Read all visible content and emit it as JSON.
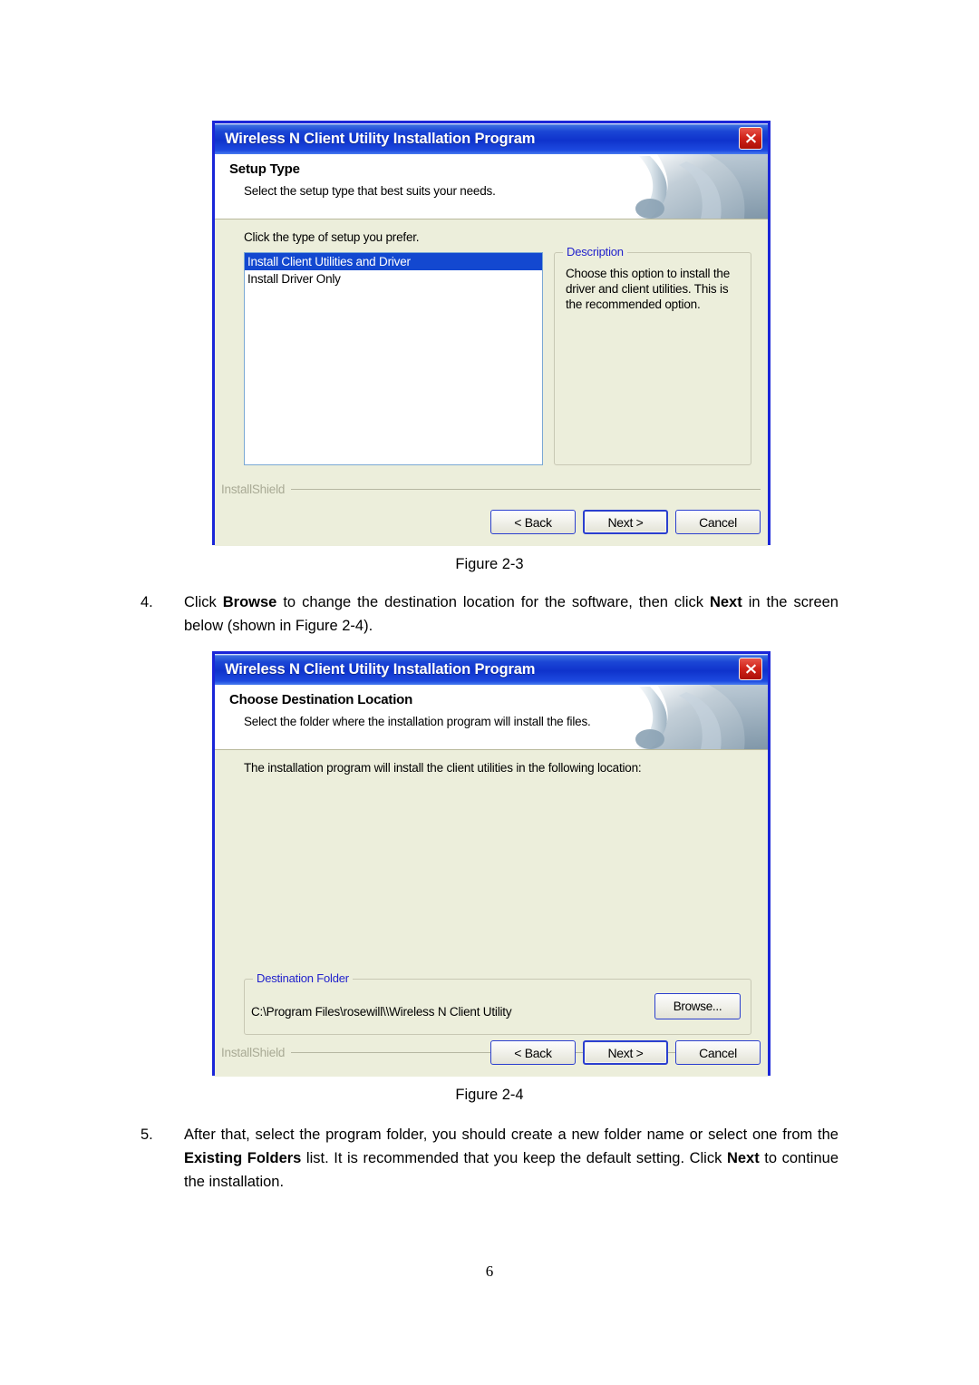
{
  "document": {
    "page_number": "6",
    "figure_3_caption": "Figure 2-3",
    "figure_4_caption": "Figure 2-4",
    "step4": {
      "number": "4.",
      "parts": [
        {
          "text": "Click ",
          "bold": false
        },
        {
          "text": "Browse",
          "bold": true
        },
        {
          "text": " to change the destination location for the software, then click ",
          "bold": false
        },
        {
          "text": "Next",
          "bold": true
        },
        {
          "text": " in the screen below (shown in Figure 2-4).",
          "bold": false
        }
      ]
    },
    "step5": {
      "number": "5.",
      "parts": [
        {
          "text": "After that, select the program folder, you should create a new folder name or select one from the ",
          "bold": false
        },
        {
          "text": "Existing Folders",
          "bold": true
        },
        {
          "text": " list. It is recommended that you keep the default setting. Click ",
          "bold": false
        },
        {
          "text": "Next",
          "bold": true
        },
        {
          "text": " to continue the installation.",
          "bold": false
        }
      ]
    }
  },
  "dialog_setup_type": {
    "title": "Wireless N Client Utility Installation Program",
    "close_icon": "close-icon",
    "header_title": "Setup Type",
    "header_subtitle": "Select the setup type that best suits your needs.",
    "prompt": "Click the type of setup you prefer.",
    "list_items": [
      {
        "label": "Install Client Utilities and Driver",
        "selected": true
      },
      {
        "label": "Install Driver Only",
        "selected": false
      }
    ],
    "description_group_label": "Description",
    "description_text": "Choose this option to install the driver and client utilities. This is the recommended option.",
    "installshield_label": "InstallShield",
    "buttons": {
      "back": "< Back",
      "next": "Next >",
      "cancel": "Cancel"
    }
  },
  "dialog_destination": {
    "title": "Wireless N Client Utility Installation Program",
    "close_icon": "close-icon",
    "header_title": "Choose Destination Location",
    "header_subtitle": "Select the folder where the installation program will install the files.",
    "prompt": "The installation program will install the client utilities in the following location:",
    "destination_group_label": "Destination Folder",
    "destination_path": "C:\\Program Files\\rosewill\\\\Wireless N Client Utility",
    "browse_button": "Browse...",
    "installshield_label": "InstallShield",
    "buttons": {
      "back": "< Back",
      "next": "Next >",
      "cancel": "Cancel"
    }
  },
  "colors": {
    "titlebar_blue": "#0f33cc",
    "dialog_border": "#1a26d8",
    "body_beige": "#eceedb",
    "selection_blue": "#1348d0",
    "close_red": "#d0231a",
    "group_label_blue": "#2222cc",
    "installshield_gray": "#a9aa95"
  }
}
